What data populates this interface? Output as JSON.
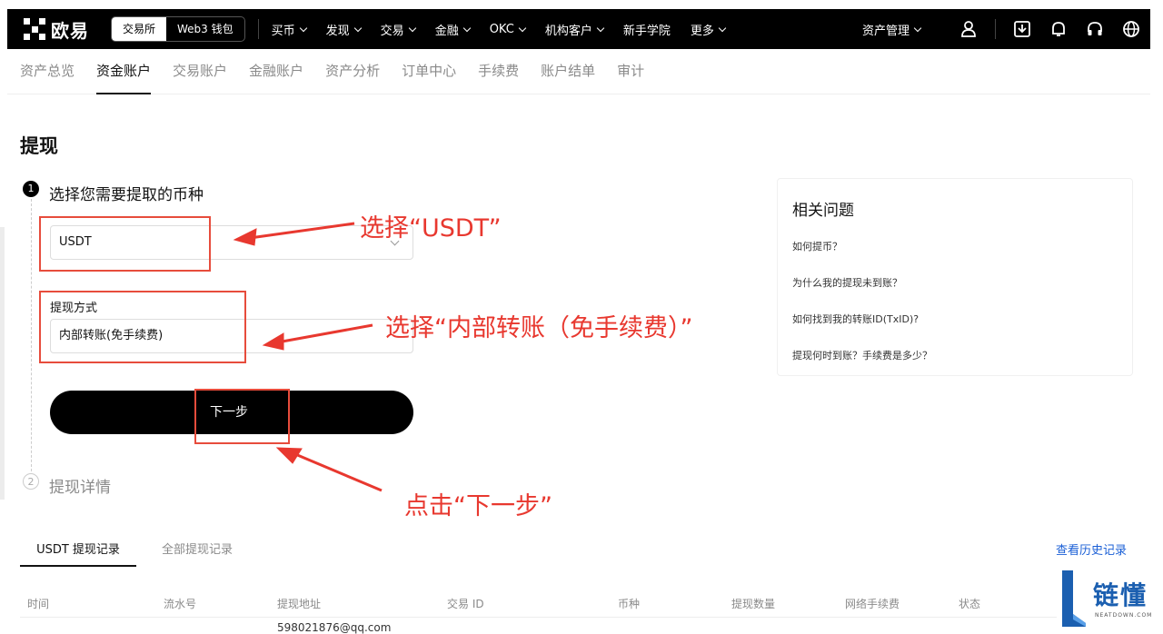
{
  "nav": {
    "logo_text": "欧易",
    "mode_tabs": [
      "交易所",
      "Web3 钱包"
    ],
    "menu": [
      "买币",
      "发现",
      "交易",
      "金融",
      "OKC",
      "机构客户",
      "新手学院",
      "更多"
    ],
    "asset_management": "资产管理"
  },
  "subnav": [
    "资产总览",
    "资金账户",
    "交易账户",
    "金融账户",
    "资产分析",
    "订单中心",
    "手续费",
    "账户结单",
    "审计"
  ],
  "page": {
    "title": "提现",
    "step1_label": "选择您需要提取的币种",
    "step2_label": "提现详情",
    "coin_value": "USDT",
    "method_label": "提现方式",
    "method_value": "内部转账(免手续费)",
    "next_button": "下一步"
  },
  "faq": {
    "title": "相关问题",
    "items": [
      "如何提币？",
      "为什么我的提现未到账？",
      "如何找到我的转账ID(TxID)?",
      "提现何时到账？手续费是多少？"
    ]
  },
  "history": {
    "tabs": [
      "USDT 提现记录",
      "全部提现记录"
    ],
    "link": "查看历史记录",
    "columns": [
      "时间",
      "流水号",
      "提现地址",
      "交易 ID",
      "币种",
      "提现数量",
      "网络手续费",
      "状态"
    ],
    "first_cell": "598021876@qq.com"
  },
  "annotations": [
    "选择“USDT”",
    "选择“内部转账（免手续费）”",
    "点击“下一步”"
  ],
  "watermark": {
    "text": "链懂",
    "sub": "NEATDOWN.COM"
  }
}
